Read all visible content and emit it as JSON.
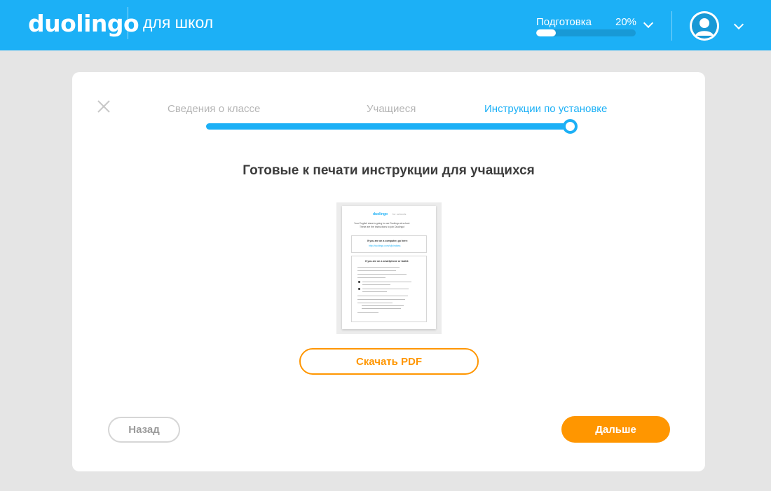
{
  "header": {
    "logo": "duolingo",
    "subtitle": "для школ",
    "progress": {
      "label": "Подготовка",
      "percent_text": "20%",
      "value": 0.2
    },
    "icons": {
      "progress_dropdown": "chevron-down-icon",
      "user_avatar": "user-avatar-icon",
      "user_dropdown": "chevron-down-icon"
    },
    "colors": {
      "brand": "#1cb0f6"
    }
  },
  "wizard": {
    "close_icon": "close-icon",
    "steps": [
      {
        "label": "Сведения о классе",
        "state": "completed"
      },
      {
        "label": "Учащиеся",
        "state": "completed"
      },
      {
        "label": "Инструкции по установке",
        "state": "current"
      }
    ],
    "title": "Готовые к печати инструкции для учащихся",
    "pdf_preview": {
      "logo": "duolingo",
      "logo_sub": "for schools",
      "intro_line1": "Your English class is going to use Duolingo at school.",
      "intro_line2": "These are the instructions to join Duolingo!",
      "computer_heading": "If you are on a computer, go here:",
      "computer_url": "http://duolingo.com/o/joinclass",
      "mobile_heading": "If you are on a smartphone or tablet:"
    },
    "download_label": "Скачать PDF",
    "back_label": "Назад",
    "next_label": "Дальше",
    "colors": {
      "accent": "#ff9600",
      "step_active": "#1cb0f6",
      "step_inactive": "#b5b5b5"
    }
  }
}
